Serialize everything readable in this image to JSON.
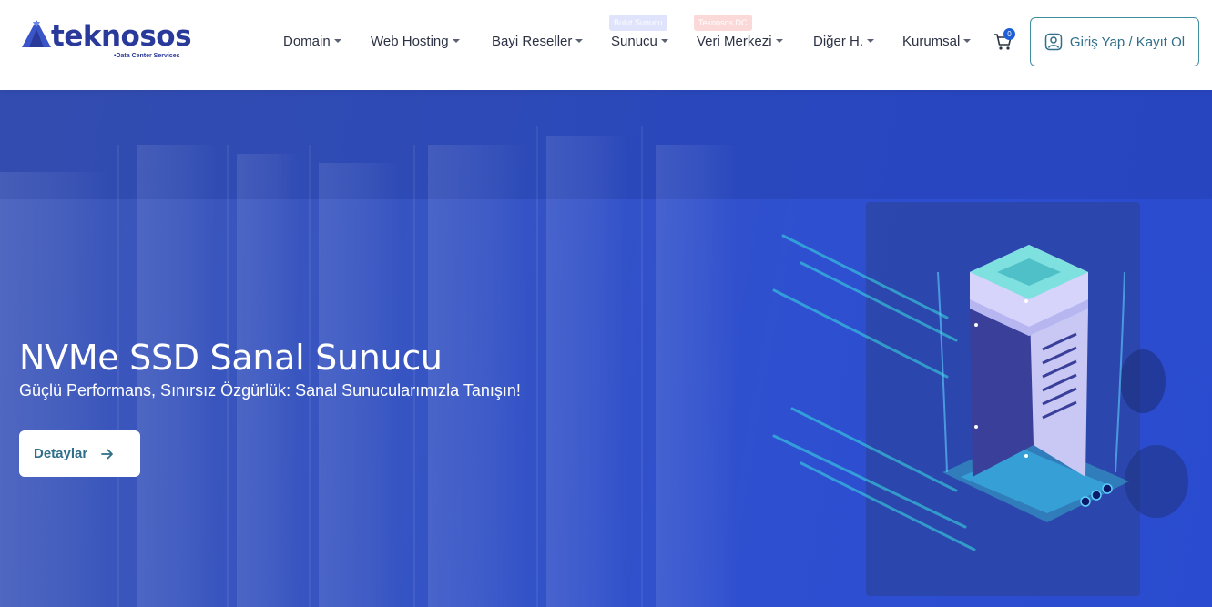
{
  "brand": {
    "name": "teknosos",
    "tagline": "•Data Center Services",
    "colors": {
      "primary": "#2a3a9a",
      "accent": "#3f8f9f",
      "hero": "#2e4fd0"
    }
  },
  "nav": {
    "items": [
      {
        "label": "Domain"
      },
      {
        "label": "Web Hosting"
      },
      {
        "label": "Bayi Reseller"
      },
      {
        "label": "Sunucu",
        "badge": "Bulut Sunucu"
      },
      {
        "label": "Veri Merkezi",
        "badge": "Teknosos DC"
      },
      {
        "label": "Diğer H."
      },
      {
        "label": "Kurumsal"
      }
    ],
    "cart_count": "0",
    "login_label": "Giriş Yap / Kayıt Ol"
  },
  "hero": {
    "title": "NVMe SSD Sanal Sunucu",
    "subtitle": "Güçlü Performans, Sınırsız Özgürlük: Sanal Sunucularımızla Tanışın!",
    "button_label": "Detaylar"
  },
  "icons": [
    "logo-mark-icon",
    "caret-down-icon",
    "cart-icon",
    "user-icon",
    "arrow-right-icon",
    "server-illustration"
  ]
}
